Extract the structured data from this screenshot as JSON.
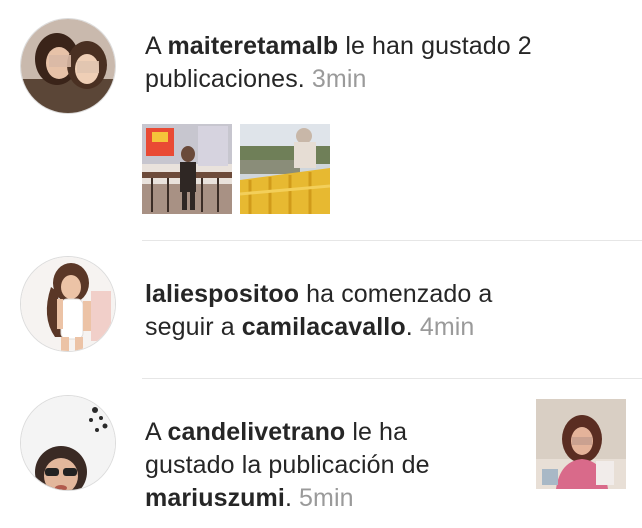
{
  "notifications": [
    {
      "avatar_icon": "avatar-two-women-icon",
      "line1_prefix": "A ",
      "line1_user": "maiteretamalb",
      "line1_suffix": " le han gustado 2",
      "line2_text": "publicaciones. ",
      "time": "3min",
      "thumbnails": [
        "post-photo-street-icon",
        "post-photo-bench-icon"
      ]
    },
    {
      "avatar_icon": "avatar-woman-white-swimsuit-icon",
      "line1_user": "laliespositoo",
      "line1_suffix": " ha comenzado a",
      "line2_prefix": "seguir a ",
      "line2_user": "camilacavallo",
      "line2_suffix": ". ",
      "time": "4min"
    },
    {
      "avatar_icon": "avatar-woman-sunglasses-icon",
      "line1_prefix": "A ",
      "line1_user": "candelivetrano",
      "line1_suffix": " le ha",
      "line2_text": "gustado la publicación de",
      "line3_user": "mariuszumi",
      "line3_suffix": ". ",
      "time": "5min",
      "thumbnail": "post-photo-girl-icon"
    }
  ]
}
